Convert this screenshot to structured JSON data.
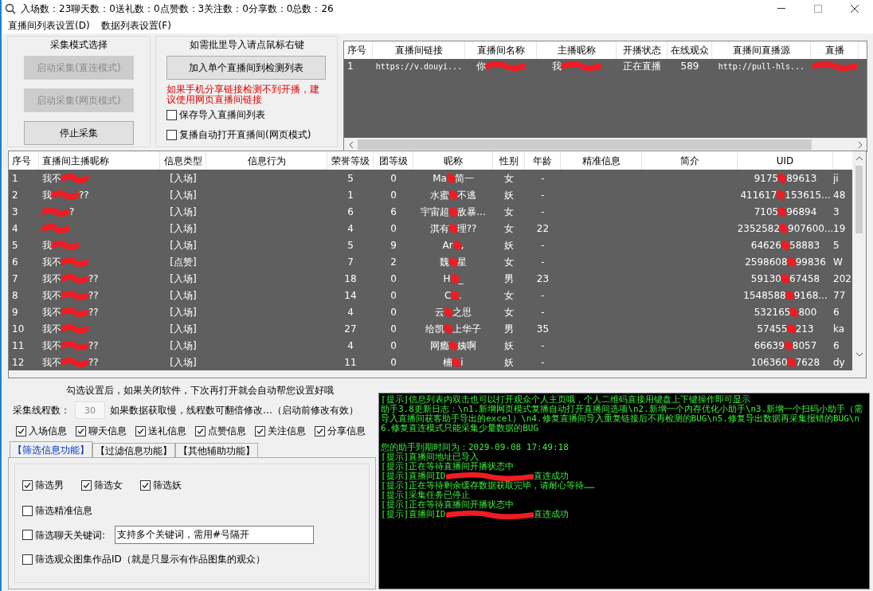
{
  "window": {
    "title": "入场数：23聊天数：0送礼数：0点赞数：3关注数：0分享数：0总数：26"
  },
  "menu": [
    "直播间列表设置(D)",
    "数据列表设置(F)"
  ],
  "mode_group": {
    "title": "采集模式选择",
    "buttons": [
      {
        "label": "启动采集(直连模式)",
        "disabled": true
      },
      {
        "label": "启动采集(网页模式)",
        "disabled": true
      },
      {
        "label": "停止采集",
        "disabled": false
      }
    ]
  },
  "import_group": {
    "title": "如需批里导入请点鼠标右键",
    "button": "加入单个直播间到检测列表",
    "warning": "如果手机分享链接检测不到开播，建议使用网页直播间链接",
    "checkboxes": [
      {
        "label": "保存导入直播间列表",
        "checked": false
      },
      {
        "label": "复播自动打开直播间(网页模式)",
        "checked": false
      }
    ]
  },
  "room_table": {
    "columns": [
      "序号",
      "直播间链接",
      "直播间名称",
      "主播昵称",
      "开播状态",
      "在线观众",
      "直播间直播源",
      "直播"
    ],
    "rows": [
      {
        "cells": [
          "1",
          "https://v.douyi...",
          [
            "你",
            ""
          ],
          [
            "我",
            ""
          ],
          "正在直播",
          "589",
          "http://pull-hls...",
          [
            "",
            ""
          ]
        ]
      }
    ]
  },
  "info_table": {
    "columns": [
      "序号",
      "直播间主播昵称",
      "信息类型",
      "信息行为",
      "荣誉等级",
      "团等级",
      "昵称",
      "性别",
      "年龄",
      "精准信息",
      "简介",
      "UID"
    ],
    "rows": [
      {
        "cells": [
          "1",
          [
            "我不",
            ""
          ],
          "[入场]",
          "",
          "5",
          "0",
          [
            "Ma",
            "简一"
          ],
          "女",
          "-",
          "",
          "",
          [
            "9175",
            "89613"
          ],
          "ji"
        ]
      },
      {
        "cells": [
          "2",
          [
            "我",
            "??"
          ],
          "[入场]",
          "",
          "1",
          "0",
          [
            "水蜜",
            "不逃"
          ],
          "妖",
          "-",
          "",
          "",
          [
            "411617",
            "153615..."
          ],
          "48"
        ]
      },
      {
        "cells": [
          "3",
          [
            "",
            "?"
          ],
          "[入场]",
          "",
          "6",
          "6",
          [
            "宇宙超",
            "敌暴..."
          ],
          "女",
          "-",
          "",
          "",
          [
            "7105",
            "96894"
          ],
          "3"
        ]
      },
      {
        "cells": [
          "4",
          [
            "",
            ""
          ],
          "[入场]",
          "",
          "4",
          "0",
          [
            "淇有",
            "理??"
          ],
          "女",
          "22",
          "",
          "",
          [
            "2352582",
            "907600..."
          ],
          "19"
        ]
      },
      {
        "cells": [
          "5",
          [
            "我",
            ""
          ],
          "[入场]",
          "",
          "5",
          "9",
          [
            "Ar",
            ","
          ],
          "妖",
          "-",
          "",
          "",
          [
            "64626",
            "58883"
          ],
          "5"
        ]
      },
      {
        "cells": [
          "6",
          [
            "我不",
            ""
          ],
          "[点赞]",
          "",
          "7",
          "2",
          [
            "魏",
            "星"
          ],
          "女",
          "-",
          "",
          "",
          [
            "2598608",
            "99836"
          ],
          "W"
        ]
      },
      {
        "cells": [
          "7",
          [
            "我不",
            "??"
          ],
          "[入场]",
          "",
          "18",
          "0",
          [
            "H",
            "_"
          ],
          "男",
          "23",
          "",
          "",
          [
            "59130",
            "67458"
          ],
          "202"
        ]
      },
      {
        "cells": [
          "8",
          [
            "我不",
            "??"
          ],
          "[入场]",
          "",
          "14",
          "0",
          [
            "C",
            "."
          ],
          "女",
          "-",
          "",
          "",
          [
            "1548588",
            "9168..."
          ],
          "77"
        ]
      },
      {
        "cells": [
          "9",
          [
            "我不",
            "??"
          ],
          "[入场]",
          "",
          "4",
          "0",
          [
            "云",
            "之思"
          ],
          "女",
          "-",
          "",
          "",
          [
            "532165",
            "800"
          ],
          "6"
        ]
      },
      {
        "cells": [
          "10",
          [
            "我不",
            ""
          ],
          "[入场]",
          "",
          "27",
          "0",
          [
            "给凯",
            "上华子"
          ],
          "男",
          "35",
          "",
          "",
          [
            "57455",
            "213"
          ],
          "ka"
        ]
      },
      {
        "cells": [
          "11",
          [
            "我不",
            "??"
          ],
          "[入场]",
          "",
          "4",
          "0",
          [
            "网瘾",
            "姨啊"
          ],
          "妖",
          "-",
          "",
          "",
          [
            "66639",
            "8057"
          ],
          "6"
        ]
      },
      {
        "cells": [
          "12",
          [
            "我不",
            "??"
          ],
          "[入场]",
          "",
          "11",
          "0",
          [
            "楠",
            "i"
          ],
          "妖",
          "-",
          "",
          "",
          [
            "106360",
            "7628"
          ],
          "dy"
        ]
      }
    ]
  },
  "settings": {
    "hint": "勾选设置后，如果关闭软件，下次再打开就会自动帮您设置好哦",
    "threads": {
      "label": "采集线程数：",
      "value": "30",
      "disabled": true,
      "note": "如果数据获取慢，线程数可翻倍修改…（启动前修改有效）"
    },
    "info_types": [
      {
        "label": "入场信息",
        "checked": true
      },
      {
        "label": "聊天信息",
        "checked": true
      },
      {
        "label": "送礼信息",
        "checked": true
      },
      {
        "label": "点赞信息",
        "checked": true
      },
      {
        "label": "关注信息",
        "checked": true
      },
      {
        "label": "分享信息",
        "checked": true
      }
    ],
    "tabs": [
      {
        "label": "【筛选信息功能】",
        "selected": true
      },
      {
        "label": "【过滤信息功能】",
        "selected": false
      },
      {
        "label": "【其他辅助功能】",
        "selected": false
      }
    ],
    "filter_items": [
      {
        "kind": "checkbox_row",
        "items": [
          {
            "label": "筛选男",
            "checked": true
          },
          {
            "label": "筛选女",
            "checked": true
          },
          {
            "label": "筛选妖",
            "checked": true
          }
        ]
      },
      {
        "kind": "checkbox",
        "label": "筛选精准信息",
        "checked": false
      },
      {
        "kind": "checkbox_field",
        "label": "筛选聊天关键词:",
        "checked": false,
        "value": "支持多个关键词，需用#号隔开"
      },
      {
        "kind": "checkbox",
        "label": "筛选观众图集作品ID（就是只显示有作品图集的观众）",
        "checked": false
      }
    ]
  },
  "log": {
    "notes": [
      {
        "text": "[提示]信息列表内双击也可以打开观众个人主页哦，个人二维码直接用键盘上下键操作即可显示"
      },
      {
        "text": "助手3.8更新日志：\\n1.新增网页模式复播自动打开直播间选项\\n2.新增一个内存优化小助手\\n3.新增一个扫码小助手（需导入直播间获客助手导出的excel）\\n4.修复直播间导入重复链接后不再检测的BUG\\n5.修复导出数据再采集报错的BUG\\n6.修复直连模式只能采集少量数据的BUG"
      }
    ],
    "status": [
      {
        "text": "您的助手到期时间为：2029-09-08 17:49:18"
      },
      {
        "text": "[提示]直播间地址已导入"
      },
      {
        "text": "[提示]正在等待直播间开播状态中"
      },
      {
        "parts": [
          "[提示]直播间ID",
          "直连成功"
        ]
      },
      {
        "text": "[提示]正在等待剩余缓存数据获取完毕，请耐心等待……"
      },
      {
        "text": "[提示]采集任务已停止"
      },
      {
        "text": "[提示]正在等待直播间开播状态中"
      },
      {
        "parts": [
          "[提示]直播间ID",
          "直连成功"
        ]
      }
    ]
  }
}
